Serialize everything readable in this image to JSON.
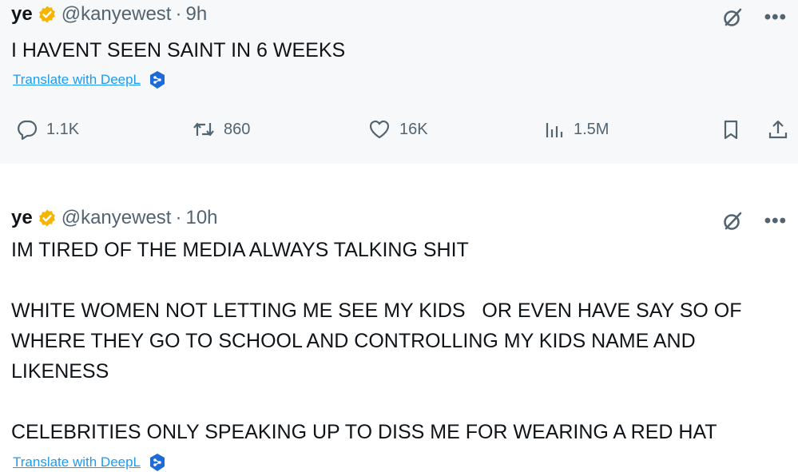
{
  "tweets": [
    {
      "display_name": "ye",
      "handle": "@kanyewest",
      "separator": "·",
      "time": "9h",
      "text": "I HAVENT SEEN SAINT IN 6 WEEKS",
      "translate": "Translate with DeepL",
      "stats": {
        "replies": "1.1K",
        "reposts": "860",
        "likes": "16K",
        "views": "1.5M"
      }
    },
    {
      "display_name": "ye",
      "handle": "@kanyewest",
      "separator": "·",
      "time": "10h",
      "text": "IM TIRED OF THE MEDIA ALWAYS TALKING SHIT\n\nWHITE WOMEN NOT LETTING ME SEE MY KIDS   OR EVEN HAVE SAY SO OF WHERE THEY GO TO SCHOOL AND CONTROLLING MY KIDS NAME AND LIKENESS\n\nCELEBRITIES ONLY SPEAKING UP TO DISS ME FOR WEARING A RED HAT",
      "translate": "Translate with DeepL"
    }
  ],
  "colors": {
    "verified_badge": "#f4b400",
    "secondary_text": "#536471",
    "link": "#1d9bf0",
    "deepl": "#1e6ad6"
  },
  "icons": [
    "verified-badge-icon",
    "grok-icon",
    "more-icon",
    "deepl-icon",
    "reply-icon",
    "retweet-icon",
    "like-icon",
    "views-icon",
    "bookmark-icon",
    "share-icon"
  ]
}
